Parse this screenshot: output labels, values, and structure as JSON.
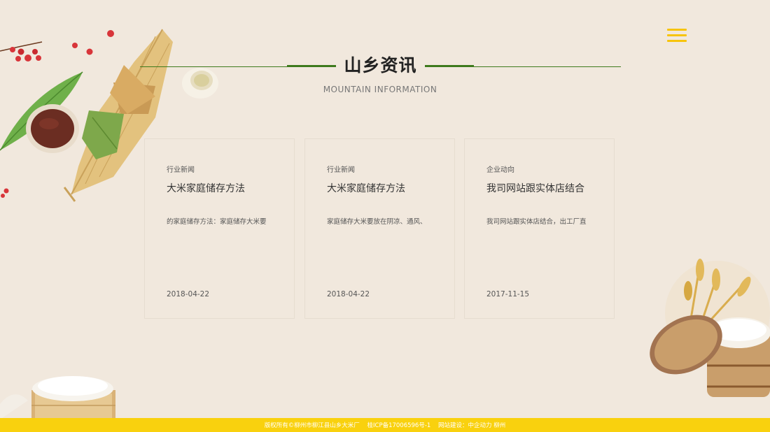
{
  "header": {
    "title": "山乡资讯",
    "subtitle": "MOUNTAIN  INFORMATION",
    "menu_icon": "hamburger-menu-icon"
  },
  "news": [
    {
      "category": "行业新闻",
      "title": "大米家庭储存方法",
      "summary": "的家庭储存方法：家庭储存大米要",
      "date": "2018-04-22"
    },
    {
      "category": "行业新闻",
      "title": "大米家庭储存方法",
      "summary": "家庭储存大米要放在阴凉、通风、",
      "date": "2018-04-22"
    },
    {
      "category": "企业动向",
      "title": "我司网站跟实体店结合",
      "summary": "我司网站跟实体店结合，出工厂直",
      "date": "2017-11-15"
    }
  ],
  "footer": {
    "copyright": "版权所有©柳州市柳江县山乡大米厂",
    "icp": "桂ICP备17006596号-1",
    "builder": "网站建设：中企动力  柳州"
  },
  "colors": {
    "background": "#f1e8dd",
    "accent_yellow": "#f9d10e",
    "title_green": "#3e7a1c"
  }
}
